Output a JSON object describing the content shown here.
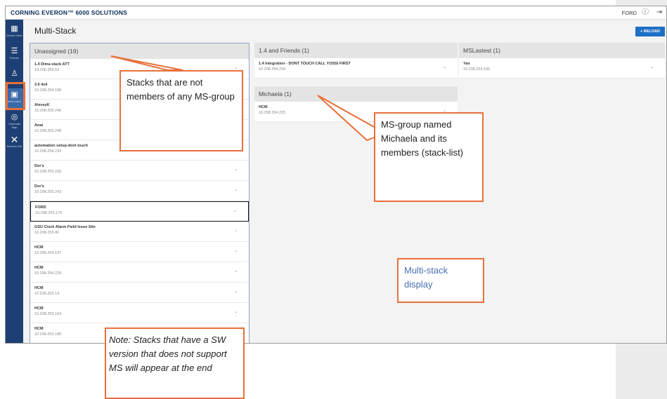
{
  "app": {
    "brand": "CORNING EVERON™ 6000 SOLUTIONS",
    "user": "FORD",
    "info_icon": "info-icon",
    "logout_icon": "logout-icon"
  },
  "sidebar": {
    "items": [
      {
        "label": "Device View",
        "icon": "grid-icon"
      },
      {
        "label": "Events",
        "icon": "list-icon"
      },
      {
        "label": "Users",
        "icon": "user-icon"
      },
      {
        "label": "Multi-stack",
        "icon": "multistack-icon"
      },
      {
        "label": "Channels Map",
        "icon": "channels-icon"
      },
      {
        "label": "Devices Ctrl",
        "icon": "tools-icon"
      }
    ]
  },
  "main": {
    "title": "Multi-Stack",
    "reload_label": "+ RELOAD",
    "columns": {
      "unassigned": {
        "header": "Unassigned (19)",
        "stacks": [
          {
            "name": "1.4 Dima stack ATT",
            "ip": "10.208.255.53"
          },
          {
            "name": "3.6 4x4",
            "ip": "10.208.254.196"
          },
          {
            "name": "AlexeyK",
            "ip": "10.208.255.246"
          },
          {
            "name": "Anat",
            "ip": "10.208.255.248"
          },
          {
            "name": "automation setup-dont touch",
            "ip": "10.208.254.233"
          },
          {
            "name": "Dor's",
            "ip": "10.208.255.156"
          },
          {
            "name": "Dor's",
            "ip": "10.208.255.243"
          },
          {
            "name": "FORD",
            "ip": "10.208.255.175"
          },
          {
            "name": "GSU Clock Alarm Field Issue Site",
            "ip": "10.208.255.45"
          },
          {
            "name": "HCM",
            "ip": "10.208.254.197"
          },
          {
            "name": "HCM",
            "ip": "10.208.254.229"
          },
          {
            "name": "HCM",
            "ip": "10.208.255.14"
          },
          {
            "name": "HCM",
            "ip": "10.208.255.164"
          },
          {
            "name": "HCM",
            "ip": "10.208.255.180"
          }
        ]
      },
      "friends": {
        "header": "1.4 and Friends (1)",
        "stacks": [
          {
            "name": "1.4 Integration - DONT TOUCH CALL YOSSI FIRST",
            "ip": "10.208.254.234"
          }
        ]
      },
      "michaela": {
        "header": "Michaela (1)",
        "stacks": [
          {
            "name": "HCM",
            "ip": "10.208.254.225"
          }
        ]
      },
      "mslastest": {
        "header": "MSLastest (1)",
        "stacks": [
          {
            "name": "Yan",
            "ip": "10.208.254.166"
          }
        ]
      }
    }
  },
  "callouts": {
    "unassigned": "Stacks that are not members of any MS-group",
    "ms_group": "MS-group named Michaela and its members (stack-list)",
    "display": "Multi-stack display",
    "note": "Note: Stacks that have a SW version that does not support MS will appear at the end"
  }
}
